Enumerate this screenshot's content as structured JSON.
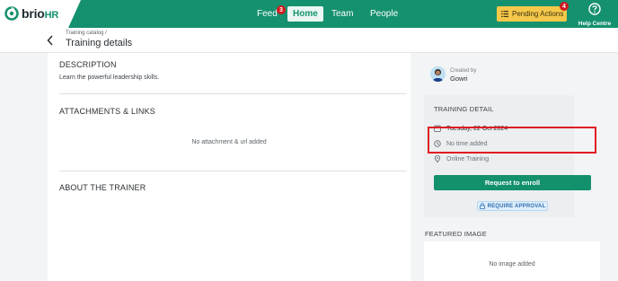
{
  "brand": {
    "name": "brio",
    "suffix": "HR"
  },
  "nav": {
    "feed": {
      "label": "Feed",
      "badge": "3"
    },
    "home": {
      "label": "Home"
    },
    "team": {
      "label": "Team"
    },
    "people": {
      "label": "People"
    },
    "pending": {
      "label": "Pending Actions",
      "badge": "4"
    },
    "help": {
      "label": "Help Centre"
    }
  },
  "header": {
    "breadcrumb": "Training catalog /",
    "title": "Training details"
  },
  "main": {
    "description_title": "DESCRIPTION",
    "description_text": "Learn the powerful leadership skills.",
    "attachments_title": "ATTACHMENTS & LINKS",
    "no_attachments": "No attachment & url added",
    "trainer_title": "ABOUT THE TRAINER"
  },
  "sidebar": {
    "created_label": "Created by",
    "created_name": "Gowri",
    "detail_title": "TRAINING DETAIL",
    "date": "Tuesday, 22 Oct 2024",
    "time": "No time added",
    "mode": "Online Training",
    "enroll_label": "Request to enroll",
    "approval_label": "REQUIRE APPROVAL",
    "featured_title": "FEATURED IMAGE",
    "no_image": "No image added"
  },
  "colors": {
    "brand_green": "#15916f",
    "badge_red": "#d0191f",
    "pending_yellow": "#f5c84a",
    "highlight_red": "#e01b22",
    "approval_blue": "#2c6fb1"
  },
  "icons": [
    "brio-logo-icon",
    "back-arrow-icon",
    "list-icon",
    "help-circle-icon",
    "calendar-icon",
    "clock-icon",
    "location-pin-icon",
    "lock-icon"
  ]
}
